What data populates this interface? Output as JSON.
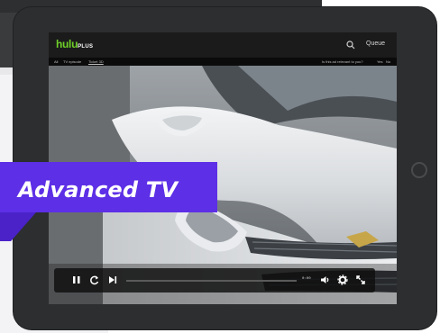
{
  "hulu": {
    "logo": "hulu",
    "logo_plus": "PLUS",
    "queue": "Queue"
  },
  "subbar": {
    "item1": "All",
    "item2": "TV episode",
    "item3": "Ticket 3D",
    "question": "Is this ad relevant to you?",
    "yes": "Yes",
    "no": "No"
  },
  "player": {
    "time": "0:00",
    "progress": 0.0
  },
  "banner": {
    "title": "Advanced TV"
  },
  "colors": {
    "accent": "#5d2fe6",
    "hulu_green": "#6fcf29"
  },
  "icons": [
    "search-icon",
    "pause-icon",
    "replay-icon",
    "skip-next-icon",
    "volume-icon",
    "settings-icon",
    "fullscreen-icon"
  ]
}
